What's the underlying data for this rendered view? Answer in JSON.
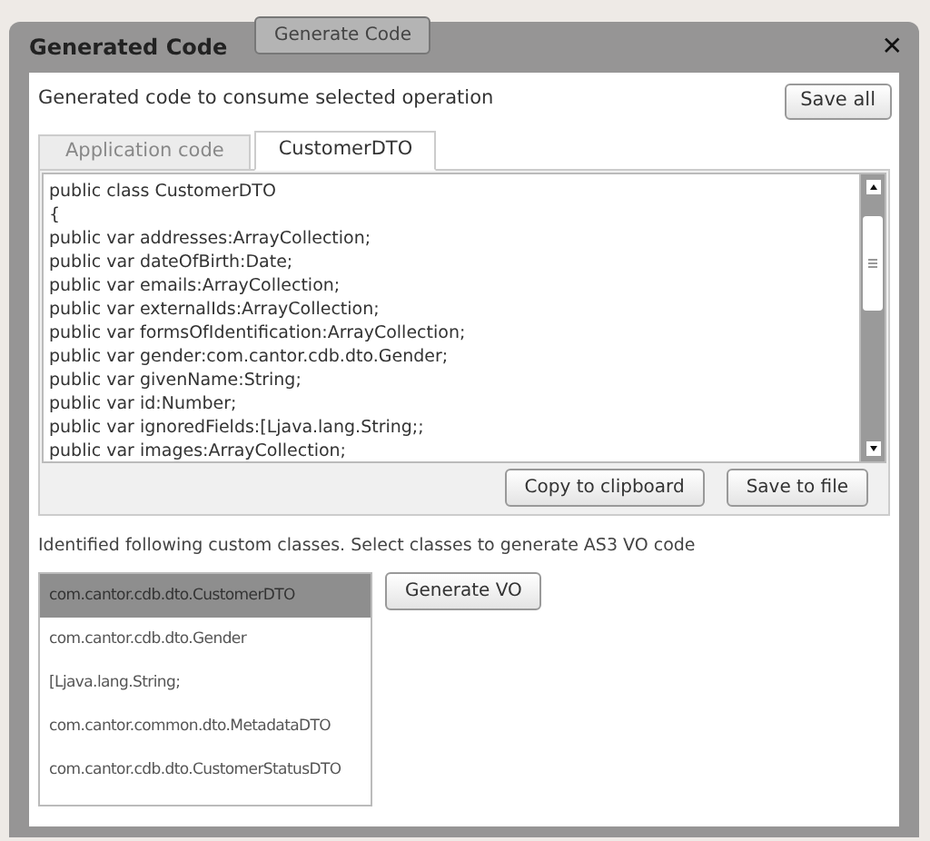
{
  "background_buttons": [
    "Generate Code"
  ],
  "window": {
    "title": "Generated Code",
    "close": "✕"
  },
  "description": "Generated code to consume selected operation",
  "save_all": "Save all",
  "tabs": [
    {
      "label": "Application code",
      "selected": false
    },
    {
      "label": "CustomerDTO",
      "selected": true
    }
  ],
  "code_lines": [
    "public class CustomerDTO",
    "{",
    "public var addresses:ArrayCollection;",
    "public var dateOfBirth:Date;",
    "public var emails:ArrayCollection;",
    "public var externalIds:ArrayCollection;",
    "public var formsOfIdentification:ArrayCollection;",
    "public var gender:com.cantor.cdb.dto.Gender;",
    "public var givenName:String;",
    "public var id:Number;",
    "public var ignoredFields:[Ljava.lang.String;;",
    "public var images:ArrayCollection;"
  ],
  "code_buttons": [
    "Copy to clipboard",
    "Save to file"
  ],
  "classes_hint": "Identified following custom classes. Select classes to generate AS3 VO code",
  "classes": [
    {
      "label": "com.cantor.cdb.dto.CustomerDTO",
      "selected": true
    },
    {
      "label": "com.cantor.cdb.dto.Gender",
      "selected": false
    },
    {
      "label": "[Ljava.lang.String;",
      "selected": false
    },
    {
      "label": "com.cantor.common.dto.MetadataDTO",
      "selected": false
    },
    {
      "label": "com.cantor.cdb.dto.CustomerStatusDTO",
      "selected": false
    }
  ],
  "generate_button": "Generate VO"
}
